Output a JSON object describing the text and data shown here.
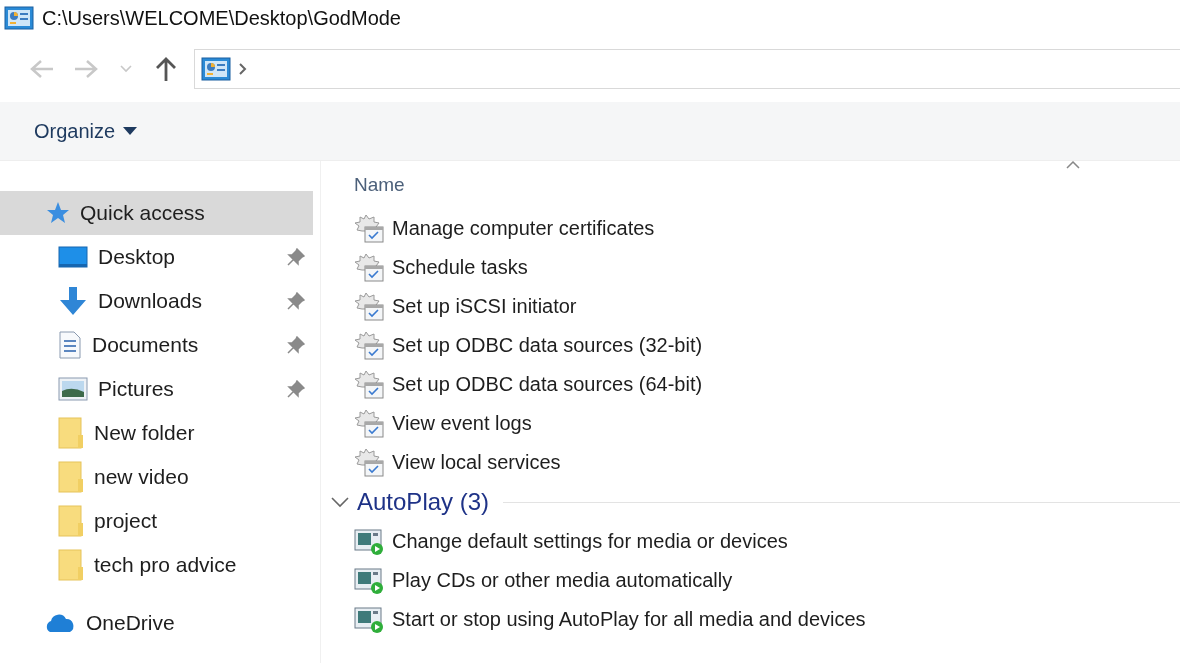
{
  "window": {
    "title": "C:\\Users\\WELCOME\\Desktop\\GodMode"
  },
  "nav": {
    "back_disabled": true,
    "forward_disabled": true
  },
  "toolbar": {
    "organize": "Organize"
  },
  "sidebar": {
    "items": [
      {
        "label": "Quick access",
        "kind": "star",
        "pinned": false,
        "selected": true
      },
      {
        "label": "Desktop",
        "kind": "desktop",
        "pinned": true,
        "selected": false
      },
      {
        "label": "Downloads",
        "kind": "download",
        "pinned": true,
        "selected": false
      },
      {
        "label": "Documents",
        "kind": "document",
        "pinned": true,
        "selected": false
      },
      {
        "label": "Pictures",
        "kind": "picture",
        "pinned": true,
        "selected": false
      },
      {
        "label": "New folder",
        "kind": "folder",
        "pinned": false,
        "selected": false
      },
      {
        "label": "new video",
        "kind": "folder",
        "pinned": false,
        "selected": false
      },
      {
        "label": "project",
        "kind": "folder",
        "pinned": false,
        "selected": false
      },
      {
        "label": "tech pro advice",
        "kind": "folder",
        "pinned": false,
        "selected": false
      },
      {
        "label": "OneDrive",
        "kind": "cloud",
        "pinned": false,
        "selected": false
      }
    ]
  },
  "content": {
    "name_column": "Name",
    "items": [
      {
        "label": "Manage computer certificates",
        "kind": "admin-tool"
      },
      {
        "label": "Schedule tasks",
        "kind": "admin-tool"
      },
      {
        "label": "Set up iSCSI initiator",
        "kind": "admin-tool"
      },
      {
        "label": "Set up ODBC data sources (32-bit)",
        "kind": "admin-tool"
      },
      {
        "label": "Set up ODBC data sources (64-bit)",
        "kind": "admin-tool"
      },
      {
        "label": "View event logs",
        "kind": "admin-tool"
      },
      {
        "label": "View local services",
        "kind": "admin-tool"
      }
    ],
    "groups": [
      {
        "title": "AutoPlay (3)",
        "expanded": true,
        "items": [
          {
            "label": "Change default settings for media or devices",
            "kind": "autoplay"
          },
          {
            "label": "Play CDs or other media automatically",
            "kind": "autoplay"
          },
          {
            "label": "Start or stop using AutoPlay for all media and devices",
            "kind": "autoplay"
          }
        ]
      }
    ]
  }
}
